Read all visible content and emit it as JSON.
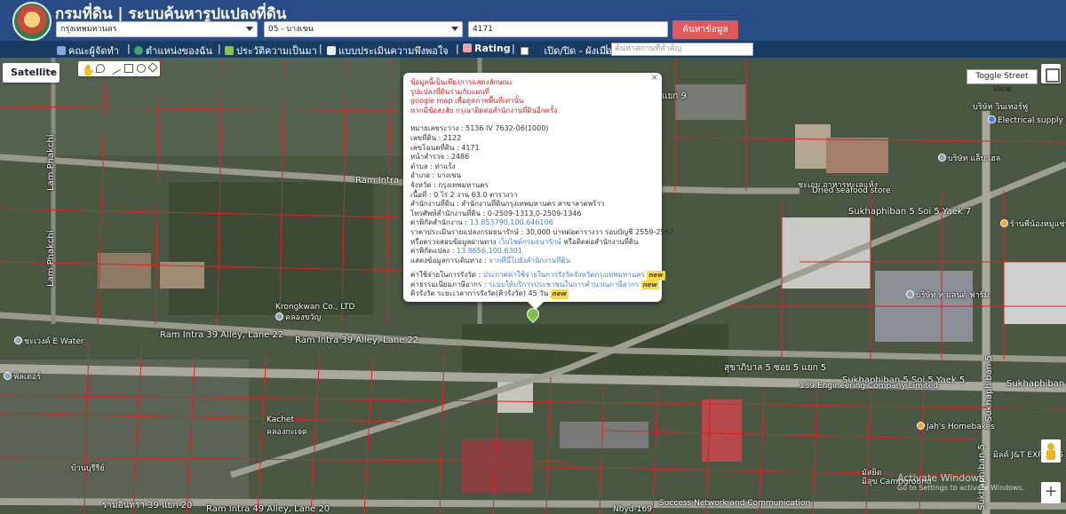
{
  "header": {
    "title": "กรมที่ดิน | ระบบค้นหารูปแปลงที่ดิน",
    "province_value": "กรุงเทพมหานคร",
    "district_value": "05 - บางเขน",
    "parcel_input": "4171",
    "search_button": "ค้นหาข้อมูล"
  },
  "nav": {
    "items": [
      {
        "label": "คณะผู้จัดทำ",
        "icon": "users-icon",
        "color": "#8aa7e0"
      },
      {
        "label": "ตำแหน่งของฉัน",
        "icon": "globe-icon",
        "color": "#39a96b"
      },
      {
        "label": "ประวัติความเป็นมา",
        "icon": "leaf-icon",
        "color": "#8bc34a"
      },
      {
        "label": "แบบประเมินความพึงพอใจ",
        "icon": "document-icon",
        "color": "#f0f0f0"
      },
      {
        "label": "Rating",
        "icon": "chart-icon",
        "color": "#f0a5a5"
      }
    ],
    "toggle_label": "เปิด/ปิด - ผังเมือง",
    "place_search_placeholder": "ค้นหาสถานที่สำคัญ"
  },
  "map": {
    "type_button": "Satellite",
    "street_view_button": "Toggle Street View",
    "roads": {
      "r1": "Ram Intra 39 Alley, Lane 22",
      "r2": "Ram Intra 39 Alley, Lane 22",
      "r3": "Ram Intra 39",
      "r4": "Lam Phakchi",
      "r5": "Lam Phakchi",
      "r6": "Sukhaphiban 5 Soi 5 Yaek 7",
      "r7": "สุขาภิบาล 5 ซอย 5 แยก 5",
      "r8": "Sukhaphiban 5 Soi 5 Yaek 5",
      "r9": "Sukhaphiban 5",
      "r10": "Sukhaphiban 5",
      "r11": "รามอินทรา 39 แยก 20",
      "r12": "Ram Intra 49 Alley, Lane 20",
      "r13": "Sukhaphiban 5",
      "r14": "แยก 9"
    },
    "places": {
      "p1": "Krongkwan Co., LTD",
      "p2": "คลองขวัญ",
      "p3": "Kachet",
      "p4": "คลองกะเจด",
      "p5": "ชะเวงค์ E Water",
      "p6": "ฟิลเตอร์",
      "p7": "มัสยิด",
      "p8": "บ้านบุรีรีย์",
      "p9": "Jah's Homebakes",
      "p10": "ชะเอม อาหารทะเลแห้ง",
      "p11": "Dried seafood store",
      "p12": "บริษัท วินเทอร์ฟู",
      "p13": "Electrical supply store",
      "p14": "บริษัท แล็บ เฮล",
      "p15": "139 Engineering Company Limited",
      "p16": "Success Network and Communication",
      "p17": "มิลค์ J&T EXPRESS",
      "p18": "บริษัท ท แลนด์ ฟาร์ม",
      "p19": "ร้านพี่น้องหมูแซ่บ",
      "p20": "มิสุข Campground",
      "p21": "Nbyd-169"
    },
    "watermark_title": "Activate Windows",
    "watermark_sub": "Go to Settings to activate Windows."
  },
  "popup": {
    "notice": [
      "ข้อมูลนี้เป็นเพียงการแสดงลักษณะ",
      "รูปแปลงที่ดินร่วมกับแผนที่",
      "google map เพื่อดูสภาพพื้นที่เท่านั้น",
      "หากมีข้อสงสัย กรุณาติดต่อสำนักงานที่ดินอีกครั้ง"
    ],
    "fields": [
      {
        "label": "หมายเลขระวาง",
        "value": "5136 IV 7632-06(1000)"
      },
      {
        "label": "เลขที่ดิน",
        "value": "2122"
      },
      {
        "label": "เลขโฉนดที่ดิน",
        "value": "4171"
      },
      {
        "label": "หน้าสำรวจ",
        "value": "2486"
      },
      {
        "label": "ตำบล",
        "value": "ท่าแร้ง"
      },
      {
        "label": "อำเภอ",
        "value": "บางเขน"
      },
      {
        "label": "จังหวัด",
        "value": "กรุงเทพมหานคร"
      },
      {
        "label": "เนื้อที่",
        "value": "0 ไร่ 2 งาน 63.0 ตารางวา"
      }
    ],
    "office_label": "สำนักงานที่ดิน",
    "office_value": "สำนักงานที่ดินกรุงเทพมหานคร สาขาลาดพร้าว",
    "phone_label": "โทรศัพท์สำนักงานที่ดิน",
    "phone_value": "0-2509-1313,0-2509-1346",
    "office_coord_label": "ค่าพิกัดสำนักงาน",
    "office_coord_value": "13.853790,100.646106",
    "price_text": "ราคาประเมินรายแปลงกรมธนารักษ์ : 30,000 บาทต่อตารางวา รอบบัญชี 2559-2562",
    "price_check_prefix": "หรือตรวจสอบข้อมูลผ่านทาง",
    "price_check_link": "เว็บไซต์กรมธนารักษ์",
    "price_check_suffix": "หรือติดต่อสำนักงานที่ดิน",
    "parcel_coord_label": "ค่าพิกัดแปลง",
    "parcel_coord_value": "13.8656,100.6301",
    "route_label": "แสดงข้อมูลการเดินทาง",
    "route_link": "จากที่นี่ไปยังสำนักงานที่ดิน",
    "fee1_label": "ค่าใช้จ่ายในการรังวัด",
    "fee1_link": "ประกาศค่าใช้จ่ายในการรังวัดจังหวัดกรุงเทพมหานคร",
    "fee2_label": "ค่าธรรมเนียมภาษีอากร",
    "fee2_link": "ระบบให้บริการประชาชนในการคำนวณภาษีอากร",
    "queue_text": "คิวรังวัด  ระยะเวลาการรังวัด(คิวรังวัด) 45 วัน",
    "new_tag": "new",
    "close": "×"
  }
}
